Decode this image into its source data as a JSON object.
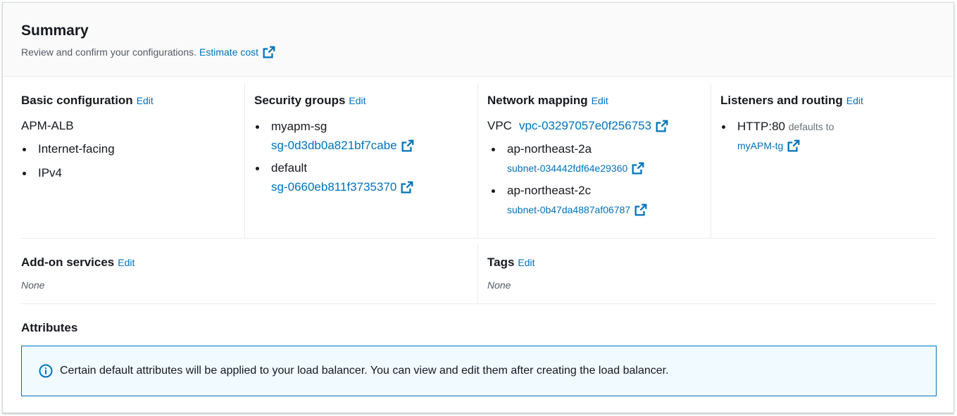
{
  "summary": {
    "title": "Summary",
    "description": "Review and confirm your configurations.",
    "estimate_cost_link": "Estimate cost"
  },
  "basic_configuration": {
    "title": "Basic configuration",
    "edit_label": "Edit",
    "name": "APM-ALB",
    "items": [
      "Internet-facing",
      "IPv4"
    ]
  },
  "security_groups": {
    "title": "Security groups",
    "edit_label": "Edit",
    "groups": [
      {
        "name": "myapm-sg",
        "id": "sg-0d3db0a821bf7cabe"
      },
      {
        "name": "default",
        "id": "sg-0660eb811f3735370"
      }
    ]
  },
  "network_mapping": {
    "title": "Network mapping",
    "edit_label": "Edit",
    "vpc_label": "VPC",
    "vpc_id": "vpc-03297057e0f256753",
    "zones": [
      {
        "name": "ap-northeast-2a",
        "subnet": "subnet-034442fdf64e29360"
      },
      {
        "name": "ap-northeast-2c",
        "subnet": "subnet-0b47da4887af06787"
      }
    ]
  },
  "listeners_routing": {
    "title": "Listeners and routing",
    "edit_label": "Edit",
    "listener": "HTTP:80",
    "defaults_to_text": "defaults to",
    "target_group": "myAPM-tg"
  },
  "addon_services": {
    "title": "Add-on services",
    "edit_label": "Edit",
    "value": "None"
  },
  "tags": {
    "title": "Tags",
    "edit_label": "Edit",
    "value": "None"
  },
  "attributes": {
    "title": "Attributes",
    "info_text": "Certain default attributes will be applied to your load balancer. You can view and edit them after creating the load balancer."
  },
  "icons": {
    "external": "external-link-icon",
    "info": "info-icon"
  },
  "colors": {
    "link": "#0073bb",
    "info_border": "#0073bb",
    "info_bg": "#f1faff"
  }
}
